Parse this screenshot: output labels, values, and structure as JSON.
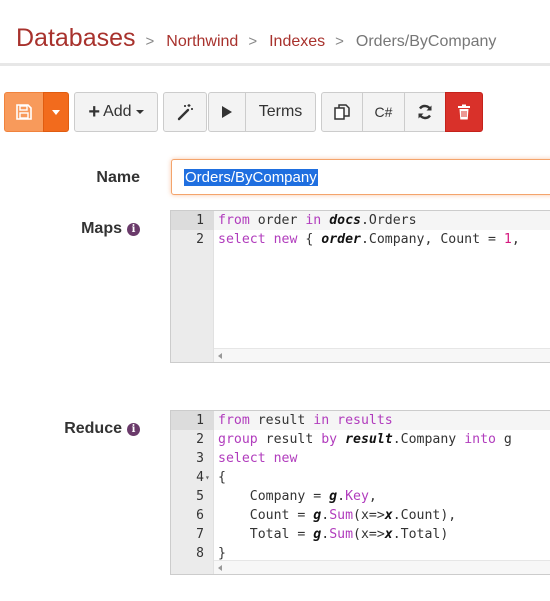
{
  "breadcrumb": {
    "root": "Databases",
    "separator": ">",
    "items": [
      "Northwind",
      "Indexes"
    ],
    "current": "Orders/ByCompany"
  },
  "toolbar": {
    "add_label": "Add",
    "terms_label": "Terms",
    "csharp_label": "C#"
  },
  "form": {
    "name_label": "Name",
    "name_value": "Orders/ByCompany",
    "maps_label": "Maps",
    "reduce_label": "Reduce",
    "info_glyph": "i"
  },
  "maps_editor": {
    "lines": [
      {
        "num": "1",
        "tokens": [
          {
            "t": "from",
            "c": "kw"
          },
          {
            "t": " order "
          },
          {
            "t": "in",
            "c": "kw"
          },
          {
            "t": " "
          },
          {
            "t": "docs",
            "c": "ib"
          },
          {
            "t": ".Orders"
          }
        ]
      },
      {
        "num": "2",
        "tokens": [
          {
            "t": "select",
            "c": "kw"
          },
          {
            "t": " "
          },
          {
            "t": "new",
            "c": "kw"
          },
          {
            "t": " { "
          },
          {
            "t": "order",
            "c": "ib"
          },
          {
            "t": ".Company, Count = "
          },
          {
            "t": "1",
            "c": "num"
          },
          {
            "t": ","
          }
        ]
      }
    ]
  },
  "reduce_editor": {
    "lines": [
      {
        "num": "1",
        "tokens": [
          {
            "t": "from",
            "c": "kw"
          },
          {
            "t": " result "
          },
          {
            "t": "in",
            "c": "kw"
          },
          {
            "t": " "
          },
          {
            "t": "results",
            "c": "kw"
          }
        ]
      },
      {
        "num": "2",
        "tokens": [
          {
            "t": "group",
            "c": "kw"
          },
          {
            "t": " result "
          },
          {
            "t": "by",
            "c": "kw"
          },
          {
            "t": " "
          },
          {
            "t": "result",
            "c": "ib"
          },
          {
            "t": ".Company "
          },
          {
            "t": "into",
            "c": "kw"
          },
          {
            "t": " g"
          }
        ]
      },
      {
        "num": "3",
        "tokens": [
          {
            "t": "select",
            "c": "kw"
          },
          {
            "t": " "
          },
          {
            "t": "new",
            "c": "kw"
          }
        ]
      },
      {
        "num": "4",
        "fold": true,
        "tokens": [
          {
            "t": "{"
          }
        ]
      },
      {
        "num": "5",
        "tokens": [
          {
            "t": "    Company = "
          },
          {
            "t": "g",
            "c": "ib"
          },
          {
            "t": "."
          },
          {
            "t": "Key",
            "c": "mem"
          },
          {
            "t": ","
          }
        ]
      },
      {
        "num": "6",
        "tokens": [
          {
            "t": "    Count = "
          },
          {
            "t": "g",
            "c": "ib"
          },
          {
            "t": "."
          },
          {
            "t": "Sum",
            "c": "mem"
          },
          {
            "t": "(x=>"
          },
          {
            "t": "x",
            "c": "ib"
          },
          {
            "t": ".Count),"
          }
        ]
      },
      {
        "num": "7",
        "tokens": [
          {
            "t": "    Total = "
          },
          {
            "t": "g",
            "c": "ib"
          },
          {
            "t": "."
          },
          {
            "t": "Sum",
            "c": "mem"
          },
          {
            "t": "(x=>"
          },
          {
            "t": "x",
            "c": "ib"
          },
          {
            "t": ".Total)"
          }
        ]
      },
      {
        "num": "8",
        "tokens": [
          {
            "t": "}"
          }
        ]
      }
    ]
  },
  "colors": {
    "brand": "#a8322d",
    "save_button": "#f89a5b",
    "save_caret": "#f26b1d",
    "delete_button": "#d9312a",
    "keyword": "#b13cbd",
    "number": "#d6197f",
    "selection": "#1f6fe0"
  },
  "icons": {
    "save": "floppy-disk-icon",
    "save_caret": "caret-down-icon",
    "add": "plus-icon",
    "wand": "magic-wand-icon",
    "run": "play-icon",
    "copy": "copy-icon",
    "refresh": "refresh-icon",
    "delete": "trash-icon",
    "info": "info-icon"
  }
}
